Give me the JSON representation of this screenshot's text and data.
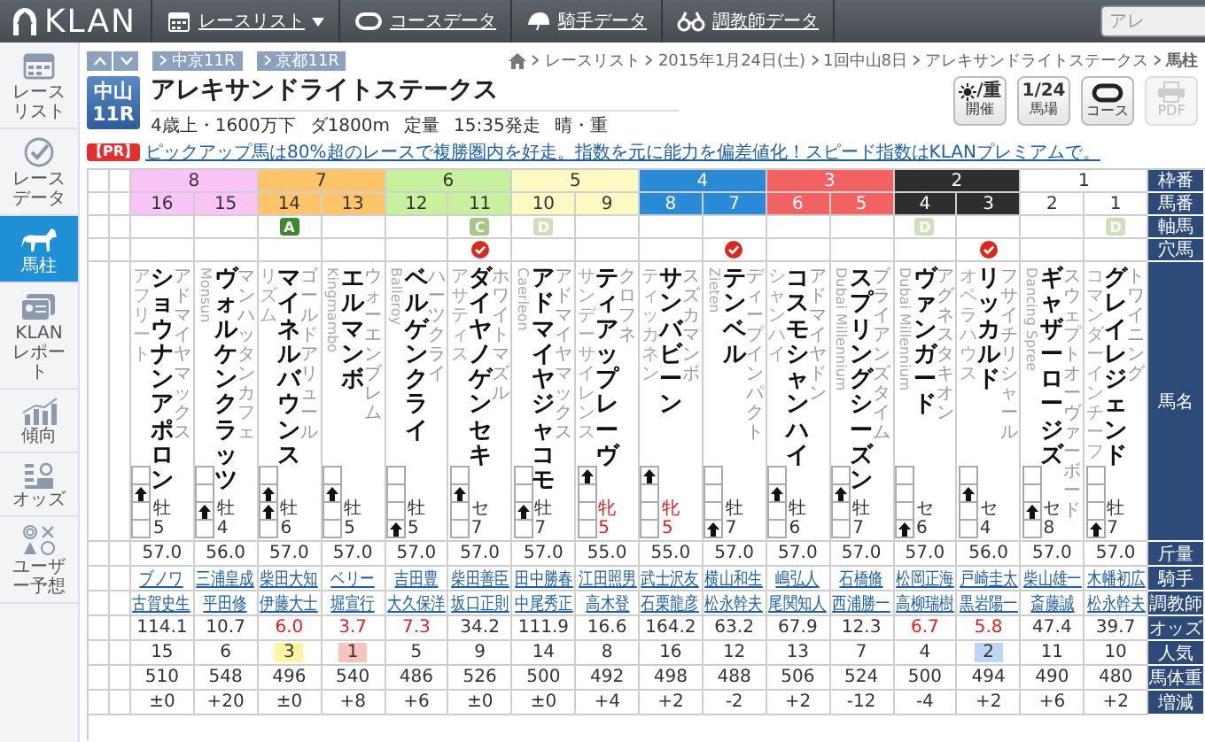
{
  "topbar": {
    "logo": "KLAN",
    "nav": [
      {
        "label": "レースリスト",
        "kind": "calendar",
        "dropdown": true
      },
      {
        "label": "コースデータ",
        "kind": "course",
        "dropdown": false
      },
      {
        "label": "騎手データ",
        "kind": "jockey",
        "dropdown": false
      },
      {
        "label": "調教師データ",
        "kind": "trainer",
        "dropdown": false
      }
    ],
    "search": {
      "placeholder": "アレ"
    }
  },
  "sidebar": {
    "items": [
      {
        "label": "レースリスト",
        "kind": "calendar",
        "selected": false
      },
      {
        "label": "レースデータ",
        "kind": "check",
        "selected": false
      },
      {
        "label": "馬柱",
        "kind": "horse",
        "selected": true
      },
      {
        "label": "KLAN レポート",
        "kind": "report",
        "selected": false
      },
      {
        "label": "傾向",
        "kind": "trend",
        "selected": false
      },
      {
        "label": "オッズ",
        "kind": "odds",
        "selected": false
      },
      {
        "label": "ユーザー予想",
        "kind": "user",
        "selected": false
      }
    ]
  },
  "race": {
    "tags": [
      "中京11R",
      "京都11R"
    ],
    "breadcrumb": [
      "レースリスト",
      "2015年1月24日(土)",
      "1回中山8日",
      "アレキサンドライトステークス",
      "馬柱"
    ],
    "venue": "中山",
    "race_no": "11R",
    "title": "アレキサンドライトステークス",
    "info": [
      "4歳上・1600万下",
      "ダ1800m",
      "定量",
      "15:35発走",
      "晴・重"
    ],
    "buttons": [
      {
        "kind": "weather",
        "icon_text": "/重",
        "label": "開催",
        "disabled": false
      },
      {
        "kind": "date",
        "icon_text": "1/24",
        "label": "馬場",
        "disabled": false
      },
      {
        "kind": "course",
        "label": "コース",
        "disabled": false
      },
      {
        "kind": "pdf",
        "label": "PDF",
        "disabled": true
      }
    ],
    "pr": {
      "badge": "【PR】",
      "text": "ピックアップ馬は80%超のレースで複勝圏内を好走。指数を元に能力を偏差値化！スピード指数はKLANプレミアムで。"
    }
  },
  "table": {
    "row_labels": [
      "枠番",
      "馬番",
      "軸馬",
      "穴馬",
      "馬名",
      "斤量",
      "騎手",
      "調教師",
      "オッズ",
      "人気",
      "馬体重",
      "増減"
    ],
    "frames": [
      {
        "label": "8",
        "color": "#f9c4f6",
        "numbers": [
          "16",
          "15"
        ]
      },
      {
        "label": "7",
        "color": "#fdc46a",
        "numbers": [
          "14",
          "13"
        ]
      },
      {
        "label": "6",
        "color": "#c7f19c",
        "numbers": [
          "12",
          "11"
        ]
      },
      {
        "label": "5",
        "color": "#fdf9c3",
        "numbers": [
          "10",
          "9"
        ]
      },
      {
        "label": "4",
        "color": "#2b8ad6",
        "numbers": [
          "8",
          "7"
        ]
      },
      {
        "label": "3",
        "color": "#f26262",
        "numbers": [
          "6",
          "5"
        ]
      },
      {
        "label": "2",
        "color": "#2e2e2e",
        "numbers": [
          "4",
          "3"
        ]
      },
      {
        "label": "1",
        "color": "#ffffff",
        "numbers": [
          "2",
          "1"
        ]
      }
    ],
    "horses": [
      {
        "sire": "アドマイヤマックス",
        "name": "ショウナンアポロン",
        "damsire": {
          "text": "アフリート",
          "kind": "kana"
        },
        "pick": false,
        "arrows": [
          false,
          true,
          false,
          false
        ],
        "sex": "牡5",
        "filly": false,
        "weight": "57.0",
        "jockey": "ブノワ",
        "trainer": "古賀史生",
        "odds": "114.1",
        "odds_hot": false,
        "popularity": {
          "rank": "15"
        },
        "body_weight": "510",
        "diff": "±0"
      },
      {
        "sire": "マンハッタンカフェ",
        "name": "ヴォルケンクラッツ",
        "damsire": {
          "text": "Monsun",
          "kind": "latin"
        },
        "pick": false,
        "arrows": [
          false,
          false,
          true,
          false
        ],
        "sex": "牡4",
        "filly": false,
        "weight": "56.0",
        "jockey": "三浦皇成",
        "trainer": "平田修",
        "odds": "10.7",
        "odds_hot": false,
        "popularity": {
          "rank": "6"
        },
        "body_weight": "548",
        "diff": "+20"
      },
      {
        "sire": "ゴールドアリュール",
        "name": "マイネルバウンス",
        "damsire": {
          "text": "リズム",
          "kind": "kana"
        },
        "mark": {
          "letter": "A",
          "color": "#3f8a2c"
        },
        "pick": false,
        "arrows": [
          false,
          true,
          true,
          false
        ],
        "sex": "牡6",
        "filly": false,
        "weight": "57.0",
        "jockey": "柴田大知",
        "trainer": "伊藤大士",
        "odds": "6.0",
        "odds_hot": true,
        "popularity": {
          "rank": "3",
          "color": "#fff5a0"
        },
        "body_weight": "496",
        "diff": "±0"
      },
      {
        "sire": "ウォーエンブレム",
        "name": "エルマンボ",
        "damsire": {
          "text": "Kingmambo",
          "kind": "latin"
        },
        "pick": false,
        "arrows": [
          false,
          true,
          false,
          false
        ],
        "sex": "牡5",
        "filly": false,
        "weight": "57.0",
        "jockey": "ベリー",
        "trainer": "堀宣行",
        "odds": "3.7",
        "odds_hot": true,
        "popularity": {
          "rank": "1",
          "color": "#f9c4bc"
        },
        "body_weight": "540",
        "diff": "+8"
      },
      {
        "sire": "ハーツクライ",
        "name": "ベルゲンクライ",
        "damsire": {
          "text": "Balleroy",
          "kind": "latin"
        },
        "pick": false,
        "arrows": [
          false,
          false,
          false,
          true
        ],
        "sex": "牡5",
        "filly": false,
        "weight": "57.0",
        "jockey": "吉田豊",
        "trainer": "大久保洋",
        "odds": "7.3",
        "odds_hot": true,
        "popularity": {
          "rank": "5"
        },
        "body_weight": "486",
        "diff": "+6"
      },
      {
        "sire": "ホワイトマズル",
        "name": "ダイヤノゲンセキ",
        "damsire": {
          "text": "アサティス",
          "kind": "kana"
        },
        "mark": {
          "letter": "C",
          "color": "#a6c785"
        },
        "pick": true,
        "arrows": [
          false,
          true,
          false,
          false
        ],
        "sex": "セ7",
        "filly": false,
        "weight": "57.0",
        "jockey": "柴田善臣",
        "trainer": "坂口正則",
        "odds": "34.2",
        "odds_hot": false,
        "popularity": {
          "rank": "9"
        },
        "body_weight": "526",
        "diff": "±0"
      },
      {
        "sire": "アドマイヤマックス",
        "name": "アドマイヤジャコモ",
        "damsire": {
          "text": "Caerleon",
          "kind": "latin"
        },
        "mark": {
          "letter": "D",
          "color": "#cde0b8"
        },
        "pick": false,
        "arrows": [
          false,
          false,
          true,
          false
        ],
        "sex": "牡7",
        "filly": false,
        "weight": "57.0",
        "jockey": "田中勝春",
        "trainer": "中尾秀正",
        "odds": "111.9",
        "odds_hot": false,
        "popularity": {
          "rank": "14"
        },
        "body_weight": "500",
        "diff": "±0"
      },
      {
        "sire": "クロフネ",
        "name": "ティアップレーヴ",
        "damsire": {
          "text": "サンデーサイレンス",
          "kind": "kana"
        },
        "pick": false,
        "arrows": [
          true,
          false,
          false,
          false
        ],
        "sex": "牝5",
        "filly": true,
        "weight": "55.0",
        "jockey": "江田照男",
        "trainer": "高木登",
        "odds": "16.6",
        "odds_hot": false,
        "popularity": {
          "rank": "8"
        },
        "body_weight": "492",
        "diff": "+4"
      },
      {
        "sire": "スズカマンボ",
        "name": "サンバビーン",
        "damsire": {
          "text": "ティッカネン",
          "kind": "kana"
        },
        "pick": false,
        "arrows": [
          true,
          false,
          false,
          false
        ],
        "sex": "牝5",
        "filly": true,
        "weight": "55.0",
        "jockey": "武士沢友",
        "trainer": "石栗龍彦",
        "odds": "164.2",
        "odds_hot": false,
        "popularity": {
          "rank": "16"
        },
        "body_weight": "498",
        "diff": "+2"
      },
      {
        "sire": "ディープインパクト",
        "name": "テンベル",
        "damsire": {
          "text": "Zieten",
          "kind": "latin"
        },
        "pick": true,
        "arrows": [
          false,
          false,
          false,
          true
        ],
        "sex": "牡7",
        "filly": false,
        "weight": "57.0",
        "jockey": "横山和生",
        "trainer": "松永幹夫",
        "odds": "63.2",
        "odds_hot": false,
        "popularity": {
          "rank": "12"
        },
        "body_weight": "488",
        "diff": "-2"
      },
      {
        "sire": "アドマイヤドン",
        "name": "コスモシャンハイ",
        "damsire": {
          "text": "シャンハイ",
          "kind": "kana"
        },
        "pick": false,
        "arrows": [
          false,
          true,
          false,
          false
        ],
        "sex": "牡6",
        "filly": false,
        "weight": "57.0",
        "jockey": "嶋弘人",
        "trainer": "尾関知人",
        "odds": "67.9",
        "odds_hot": false,
        "popularity": {
          "rank": "13"
        },
        "body_weight": "506",
        "diff": "+2"
      },
      {
        "sire": "ブライアンズタイム",
        "name": "スプリングシーズン",
        "damsire": {
          "text": "Dubai Millennium",
          "kind": "latin"
        },
        "pick": false,
        "arrows": [
          false,
          true,
          false,
          false
        ],
        "sex": "牡7",
        "filly": false,
        "weight": "57.0",
        "jockey": "石橋脩",
        "trainer": "西浦勝一",
        "odds": "12.3",
        "odds_hot": false,
        "popularity": {
          "rank": "7"
        },
        "body_weight": "524",
        "diff": "-12"
      },
      {
        "sire": "アグネスタキオン",
        "name": "ヴァンガード",
        "damsire": {
          "text": "Dubai Millennium",
          "kind": "latin"
        },
        "mark": {
          "letter": "D",
          "color": "#cde0b8"
        },
        "pick": false,
        "arrows": [
          false,
          false,
          false,
          true
        ],
        "sex": "セ6",
        "filly": false,
        "weight": "57.0",
        "jockey": "松岡正海",
        "trainer": "高柳瑞樹",
        "odds": "6.7",
        "odds_hot": true,
        "popularity": {
          "rank": "4"
        },
        "body_weight": "500",
        "diff": "-4"
      },
      {
        "sire": "フサイチリシャール",
        "name": "リッカルド",
        "damsire": {
          "text": "オペラハウス",
          "kind": "kana"
        },
        "pick": true,
        "arrows": [
          false,
          true,
          false,
          false
        ],
        "sex": "セ4",
        "filly": false,
        "weight": "56.0",
        "jockey": "戸崎圭太",
        "trainer": "黒岩陽一",
        "odds": "5.8",
        "odds_hot": true,
        "popularity": {
          "rank": "2",
          "color": "#bcd6f4"
        },
        "body_weight": "494",
        "diff": "+2"
      },
      {
        "sire": "スウェプトオーヴァーボード",
        "name": "ギャザーロージズ",
        "damsire": {
          "text": "Dancing Spree",
          "kind": "latin"
        },
        "pick": false,
        "arrows": [
          false,
          false,
          true,
          false
        ],
        "sex": "セ8",
        "filly": false,
        "weight": "57.0",
        "jockey": "柴山雄一",
        "trainer": "斎藤誠",
        "odds": "47.4",
        "odds_hot": false,
        "popularity": {
          "rank": "11"
        },
        "body_weight": "490",
        "diff": "+6"
      },
      {
        "sire": "トワイニング",
        "name": "グレイレジェンド",
        "damsire": {
          "text": "コマンダーインチーフ",
          "kind": "kana"
        },
        "mark": {
          "letter": "D",
          "color": "#cde0b8"
        },
        "pick": false,
        "arrows": [
          false,
          false,
          false,
          true
        ],
        "sex": "牡7",
        "filly": false,
        "weight": "57.0",
        "jockey": "木幡初広",
        "trainer": "松永幹夫",
        "odds": "39.7",
        "odds_hot": false,
        "popularity": {
          "rank": "10"
        },
        "body_weight": "480",
        "diff": "+2"
      }
    ]
  }
}
